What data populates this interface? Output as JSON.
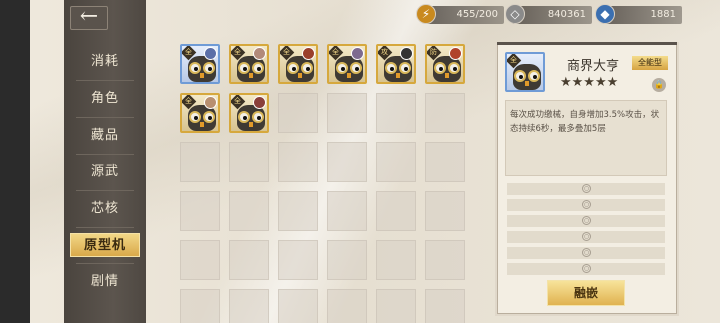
{
  "nav": {
    "back_icon": "←",
    "items": [
      {
        "label": "消耗"
      },
      {
        "label": "角色"
      },
      {
        "label": "藏品"
      },
      {
        "label": "源武"
      },
      {
        "label": "芯核"
      },
      {
        "label": "原型机"
      },
      {
        "label": "剧情"
      }
    ],
    "active_index": 5
  },
  "resources": [
    {
      "icon": "stamina-icon",
      "glyph": "⚡",
      "value": "455/200"
    },
    {
      "icon": "coin-icon",
      "glyph": "◇",
      "value": "840361"
    },
    {
      "icon": "gem-icon",
      "glyph": "◆",
      "value": "1881"
    }
  ],
  "grid": {
    "items": [
      {
        "badge": "全",
        "frame": "blue",
        "avatar_color": "#5b6fa8"
      },
      {
        "badge": "全",
        "frame": "gold",
        "avatar_color": "#b28a7a"
      },
      {
        "badge": "全",
        "frame": "gold",
        "avatar_color": "#9a3f2c"
      },
      {
        "badge": "全",
        "frame": "gold",
        "avatar_color": "#7d6a8f"
      },
      {
        "badge": "攻",
        "frame": "gold",
        "avatar_color": "#333333"
      },
      {
        "badge": "防",
        "frame": "gold",
        "avatar_color": "#b0432b"
      },
      {
        "badge": "全",
        "frame": "gold",
        "avatar_color": "#b89070"
      },
      {
        "badge": "全",
        "frame": "gold",
        "avatar_color": "#8a3f3a"
      }
    ]
  },
  "detail": {
    "name": "商界大亨",
    "tag": "全能型",
    "stars": "★★★★★",
    "lock_icon": "🔒",
    "description": "每次成功缴械，自身增加3.5%攻击，状态持续6秒，最多叠加5层",
    "slot_lock": "○",
    "embed_label": "融嵌"
  }
}
